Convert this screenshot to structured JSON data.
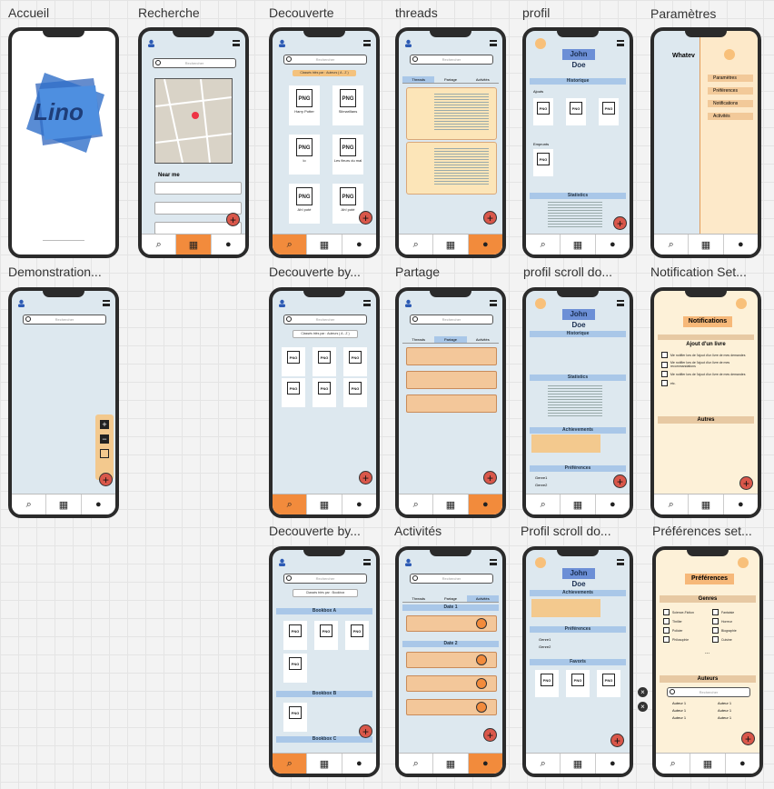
{
  "frames": {
    "accueil": "Accueil",
    "recherche": "Recherche",
    "decouverte": "Decouverte",
    "threads": "threads",
    "profil": "profil",
    "parametres": "Paramètres",
    "demonstration": "Demonstration...",
    "decouverte_by1": "Decouverte by...",
    "partage": "Partage",
    "profil_scroll1": "profil scroll do...",
    "notification_set": "Notification Set...",
    "decouverte_by2": "Decouverte by...",
    "activites": "Activités",
    "profil_scroll2": "Profil scroll do...",
    "preferences_set": "Préférences set..."
  },
  "logo": "Lino",
  "search_placeholder": "Rechercher",
  "filter_label": "Classés triés par : Auteurs ( A - Z )",
  "filter_label_bookbox": "Classés triés par : Bookbox",
  "near_me": "Near me",
  "books": [
    "Harry Potter",
    "Silmarillans",
    "lo",
    "Les fleurs du mal",
    "Ah! poté"
  ],
  "tabs": [
    "Threads",
    "Partage",
    "Activités"
  ],
  "profile_name": "John Doe",
  "sections": {
    "historique": "Historique",
    "statistics": "Statistics",
    "achievements": "Achievements",
    "preferences": "Préférences",
    "favoris": "Favoris",
    "ajouts": "Ajouts",
    "emprunts": "Emprunts"
  },
  "settings_menu": [
    "Paramètres",
    "Préférences",
    "Notifications",
    "Activités"
  ],
  "whatever": "Whatev",
  "notifications_title": "Notifications",
  "ajout_livre": "Ajout d'un livre",
  "autres": "Autres",
  "notif_options": [
    "Me notifier lors de l'ajout d'un livre de mes demandes",
    "Me notifier lors de l'ajout d'un livre de mes recommandations",
    "Me notifier lors de l'ajout d'un livre de mes demandes",
    "etc."
  ],
  "preferences_title": "Préférences",
  "genres_title": "Genres",
  "genres": [
    "Science-Fiction",
    "Thriller",
    "Policier",
    "Philosophie",
    "Fantaisie",
    "Horreur",
    "Biographie",
    "Cuisine"
  ],
  "auteurs_title": "Auteurs",
  "auteur_item": "Auteur 1",
  "genre_items": [
    "Genre1",
    "Genre2",
    "Genre1",
    "Genre2"
  ],
  "bookbox": [
    "Bookbox A",
    "Bookbox B",
    "Bookbox C"
  ],
  "dates": [
    "Date 1",
    "Date 2"
  ],
  "achievement_labels": [
    "Quand 1 cret",
    "",
    ""
  ],
  "ellipsis": "..."
}
